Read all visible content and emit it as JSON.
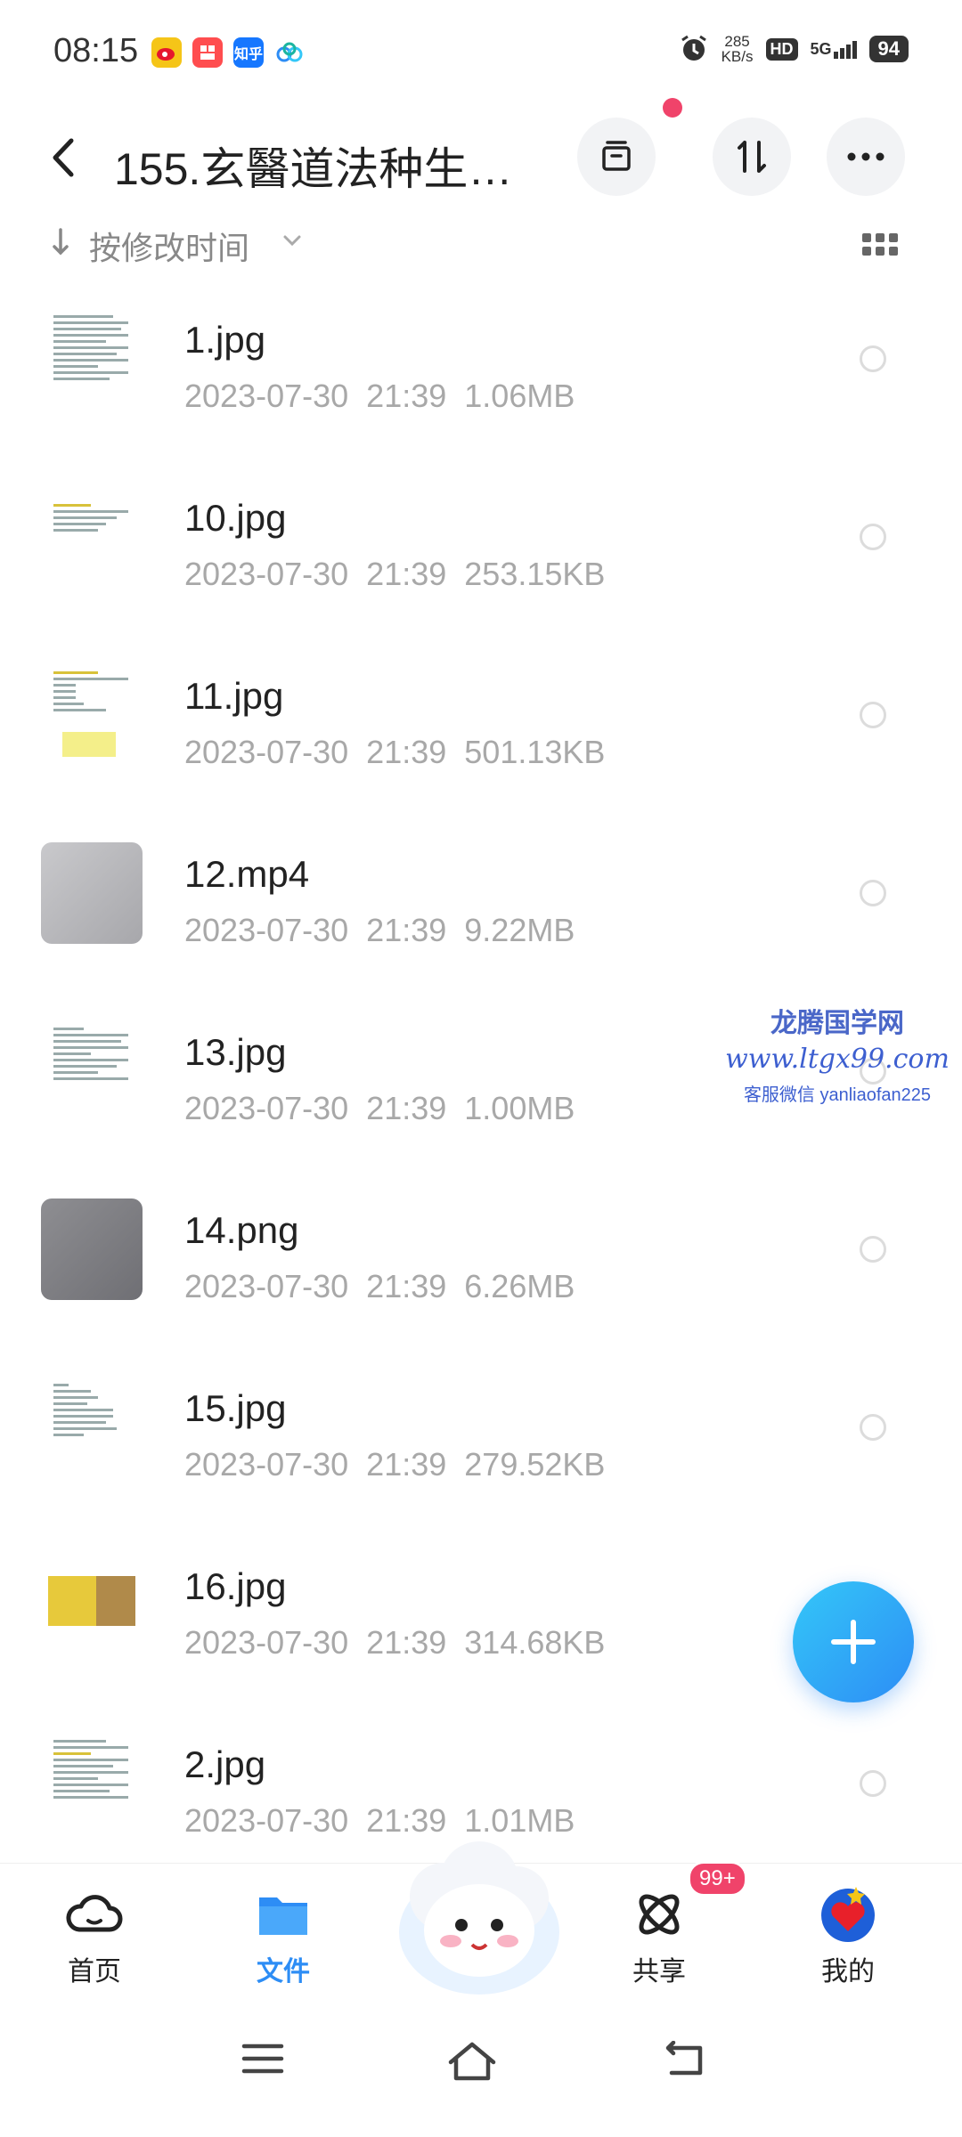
{
  "status": {
    "time": "08:15",
    "app_icons": [
      "weibo-icon",
      "xiaohongshu-icon",
      "zhihu-icon",
      "baidu-netdisk-icon"
    ],
    "zhihu_text": "知乎",
    "speed_value": "285",
    "speed_unit": "KB/s",
    "hd": "HD",
    "network": "5G",
    "battery": "94"
  },
  "header": {
    "title": "155.玄醫道法种生…"
  },
  "sort": {
    "label": "按修改时间"
  },
  "files": [
    {
      "name": "1.jpg",
      "date": "2023-07-30",
      "time": "21:39",
      "size": "1.06MB",
      "thumb": "doc"
    },
    {
      "name": "10.jpg",
      "date": "2023-07-30",
      "time": "21:39",
      "size": "253.15KB",
      "thumb": "doc"
    },
    {
      "name": "11.jpg",
      "date": "2023-07-30",
      "time": "21:39",
      "size": "501.13KB",
      "thumb": "doc"
    },
    {
      "name": "12.mp4",
      "date": "2023-07-30",
      "time": "21:39",
      "size": "9.22MB",
      "thumb": "photo"
    },
    {
      "name": "13.jpg",
      "date": "2023-07-30",
      "time": "21:39",
      "size": "1.00MB",
      "thumb": "doc"
    },
    {
      "name": "14.png",
      "date": "2023-07-30",
      "time": "21:39",
      "size": "6.26MB",
      "thumb": "photo"
    },
    {
      "name": "15.jpg",
      "date": "2023-07-30",
      "time": "21:39",
      "size": "279.52KB",
      "thumb": "doc"
    },
    {
      "name": "16.jpg",
      "date": "2023-07-30",
      "time": "21:39",
      "size": "314.68KB",
      "thumb": "doc"
    },
    {
      "name": "2.jpg",
      "date": "2023-07-30",
      "time": "21:39",
      "size": "1.01MB",
      "thumb": "doc"
    }
  ],
  "watermark": {
    "line1": "龙腾国学网",
    "line2": "www.ltgx99.com",
    "line3": "客服微信 yanliaofan225"
  },
  "nav": {
    "home": "首页",
    "files": "文件",
    "share": "共享",
    "mine": "我的",
    "share_badge": "99+"
  },
  "colors": {
    "accent": "#2d8df5",
    "badge": "#f0436a",
    "meta_text": "#a8a8a8"
  }
}
